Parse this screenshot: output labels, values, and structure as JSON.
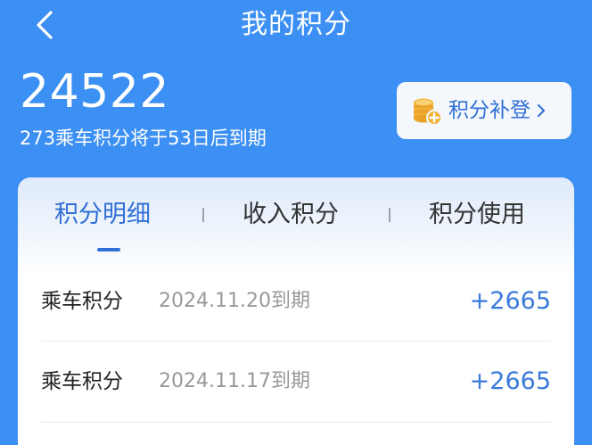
{
  "header": {
    "title": "我的积分",
    "back_icon": "chevron-left-icon"
  },
  "summary": {
    "total_points": "24522",
    "expire_note": "273乘车积分将于53日后到期"
  },
  "supplement_button": {
    "label": "积分补登",
    "icon": "coins-icon",
    "chevron": "›"
  },
  "tabs": [
    {
      "label": "积分明细",
      "active": true
    },
    {
      "label": "收入积分",
      "active": false
    },
    {
      "label": "积分使用",
      "active": false
    }
  ],
  "records": [
    {
      "title": "乘车积分",
      "date": "2024.11.20到期",
      "points": "+2665"
    },
    {
      "title": "乘车积分",
      "date": "2024.11.17到期",
      "points": "+2665"
    }
  ],
  "colors": {
    "header_bg": "#3c8ff3",
    "accent": "#2f6fd6",
    "points_blue": "#3a7ad8",
    "coin_gold": "#f2b33a"
  }
}
